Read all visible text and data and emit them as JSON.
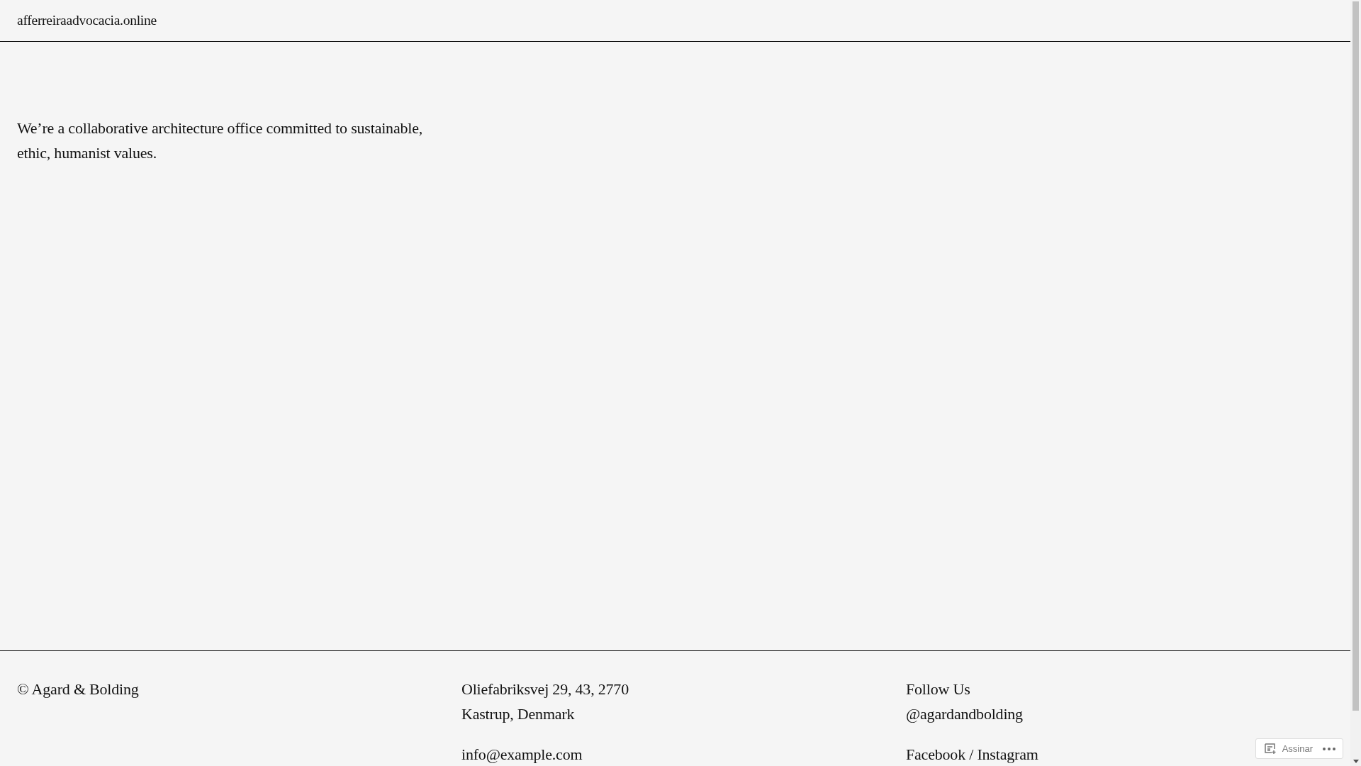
{
  "header": {
    "site_title": "afferreiraadvocacia.online"
  },
  "intro": "We’re a collaborative architecture office committed to sustainable, ethic, humanist values.",
  "footer": {
    "columns": [
      {
        "paragraphs": [
          [
            "© Agard & Bolding"
          ]
        ]
      },
      {
        "paragraphs": [
          [
            "Oliefabriksvej 29, 43, 2770",
            "Kastrup, Denmark"
          ],
          [
            "info@example.com"
          ]
        ]
      },
      {
        "paragraphs": [
          [
            "Follow Us",
            "@agardandbolding"
          ],
          [
            "Facebook / Instagram"
          ]
        ]
      }
    ]
  },
  "subscribe_widget": {
    "label": "Assinar"
  }
}
